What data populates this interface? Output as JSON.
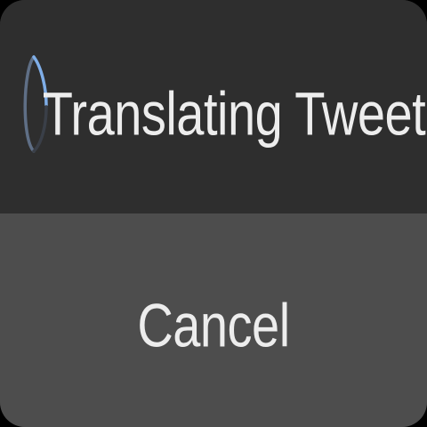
{
  "dialog": {
    "status_text": "Translating Tweet",
    "cancel_label": "Cancel",
    "icons": {
      "spinner": "progress-spinner-icon"
    },
    "colors": {
      "top_background": "#2e2e2e",
      "button_background": "#4d4d4d",
      "text": "#ededed",
      "spinner_accent": "#7faee8"
    }
  }
}
